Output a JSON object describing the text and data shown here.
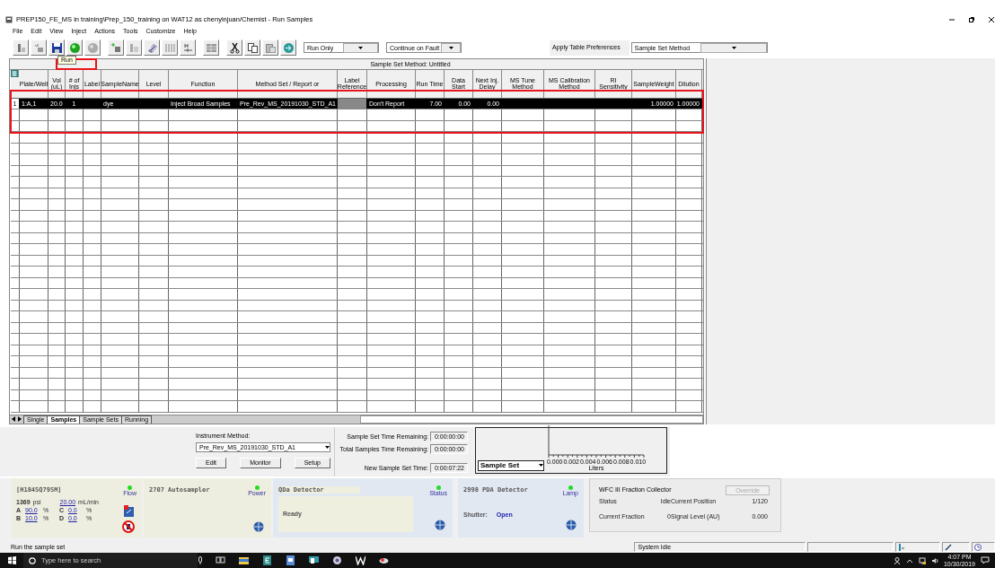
{
  "window": {
    "title": "PREP150_FE_MS in training\\Prep_150_training on WAT12 as chenyinjuan/Chemist - Run Samples"
  },
  "menu": [
    "File",
    "Edit",
    "View",
    "Inject",
    "Actions",
    "Tools",
    "Customize",
    "Help"
  ],
  "toolbar": {
    "run_mode": "Run Only",
    "fault_mode": "Continue on Fault",
    "preferences_label": "Apply Table Preferences",
    "preferences_value": "Sample Set Method"
  },
  "tooltip": "Run",
  "table": {
    "title": "Sample Set Method: Untitled",
    "columns": [
      "Plate/Well",
      "Vol (uL)",
      "# of Injs",
      "Label",
      "SampleName",
      "Level",
      "Function",
      "Method Set / Report or",
      "Label Reference",
      "Processing",
      "Run Time",
      "Data Start",
      "Next Inj. Delay",
      "MS Tune Method",
      "MS Calibration Method",
      "RI Sensitivity",
      "SampleWeight",
      "Dilution"
    ],
    "rows": [
      {
        "number": "1",
        "selected": true,
        "cells": [
          "1:A,1",
          "20.0",
          "1",
          "",
          "dye",
          "",
          "Inject Broad Samples",
          "Pre_Rev_MS_20191030_STD_A1",
          "",
          "Don't Report",
          "7.00",
          "0.00",
          "0.00",
          "",
          "",
          "",
          "1.00000",
          "1.00000"
        ]
      }
    ]
  },
  "sheet_tabs": [
    {
      "label": "Single",
      "selected": false
    },
    {
      "label": "Samples",
      "selected": true
    },
    {
      "label": "Sample Sets",
      "selected": false
    },
    {
      "label": "Running",
      "selected": false
    }
  ],
  "instrument_method": {
    "label": "Instrument Method:",
    "value": "Pre_Rev_MS_20191030_STD_A1",
    "buttons": [
      "Edit",
      "Monitor",
      "Setup"
    ]
  },
  "timers": [
    {
      "label": "Sample Set Time Remaining:",
      "value": "0:00:00:00"
    },
    {
      "label": "Total Samples Time Remaining:",
      "value": "0:00:00:00"
    },
    {
      "label": "New Sample Set Time:",
      "value": "0:00:07:22"
    }
  ],
  "volume_plot": {
    "selector": "Sample Set",
    "ticks": [
      "0.000",
      "0.002",
      "0.004",
      "0.006",
      "0.008",
      "0.010"
    ],
    "axis_label": "Liters"
  },
  "pump": {
    "title": "[H1845Q795M]",
    "led": {
      "label": "Flow",
      "on": true
    },
    "pressure": "1369",
    "pressure_unit": "psi",
    "flow": "20.00",
    "flow_unit": "mL/min",
    "solvents": [
      {
        "letter": "A",
        "value": "90.0",
        "unit": "%"
      },
      {
        "letter": "C",
        "value": "0.0",
        "unit": "%"
      },
      {
        "letter": "B",
        "value": "10.0",
        "unit": "%"
      },
      {
        "letter": "D",
        "value": "0.0",
        "unit": "%"
      }
    ]
  },
  "autosampler": {
    "title": "2707 Autosampler",
    "led": {
      "label": "Power",
      "on": true
    }
  },
  "qda": {
    "title": "QDa Detector",
    "led": {
      "label": "Status",
      "on": true
    },
    "state": "Ready"
  },
  "pda": {
    "title": "2998 PDA Detector",
    "led": {
      "label": "Lamp",
      "on": true
    },
    "shutter_label": "Shutter:",
    "shutter_value": "Open"
  },
  "fraction_collector": {
    "title": "WFC III Fraction Collector",
    "override": {
      "label": "Override",
      "disabled": true
    },
    "fields": [
      {
        "label": "Status",
        "value": "Idle"
      },
      {
        "label": "Current Position",
        "value": "1/120"
      },
      {
        "label": "Current Fraction",
        "value": "0"
      },
      {
        "label": "Signal Level (AU)",
        "value": "0.000"
      }
    ]
  },
  "status_bar": {
    "message": "Run the sample set",
    "state": "System Idle"
  },
  "taskbar": {
    "search_placeholder": "Type here to search",
    "time": "4:07 PM",
    "date": "10/30/2019"
  }
}
